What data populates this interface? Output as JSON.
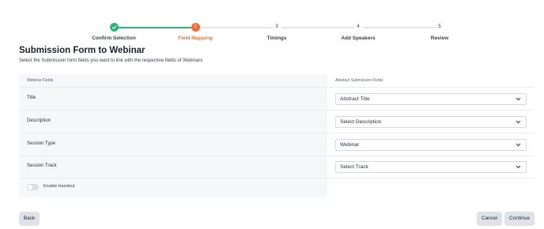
{
  "stepper": {
    "steps": [
      {
        "number": "1",
        "label": "Confirm Selection",
        "state": "complete"
      },
      {
        "number": "2",
        "label": "Field Mapping",
        "state": "active"
      },
      {
        "number": "3",
        "label": "Timings",
        "state": "pending"
      },
      {
        "number": "4",
        "label": "Add Speakers",
        "state": "pending"
      },
      {
        "number": "5",
        "label": "Review",
        "state": "pending"
      }
    ]
  },
  "page": {
    "title": "Submission Form to Webinar",
    "subtitle": "Select the Submission form fields you want to link with the respective fields of Webinars"
  },
  "table": {
    "left_header": "Webinar Fields",
    "right_header": "Abstract Submission Fields",
    "rows": [
      {
        "field": "Title",
        "value": "Abstract Title"
      },
      {
        "field": "Description",
        "value": "Select Description"
      },
      {
        "field": "Session Type",
        "value": "Webinar"
      },
      {
        "field": "Session Track",
        "value": "Select Track"
      }
    ],
    "toggle_label": "Enable Handout",
    "toggle_on": false
  },
  "buttons": {
    "back": "Back",
    "cancel": "Cancel",
    "continue": "Continue"
  },
  "colors": {
    "complete": "#2bb673",
    "active": "#ee6a3c"
  }
}
